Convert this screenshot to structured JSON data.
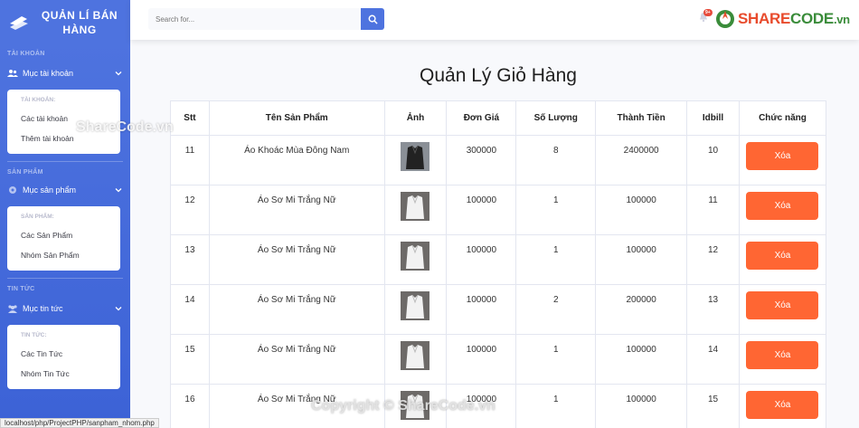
{
  "sidebar": {
    "brand": "QUẢN LÍ BÁN HÀNG",
    "sections": [
      {
        "heading": "TÀI KHOẢN",
        "toggle": "Mục tài khoản",
        "menu_header": "TÀI KHOẢN:",
        "items": [
          "Các tài khoản",
          "Thêm tài khoản"
        ]
      },
      {
        "heading": "SẢN PHẨM",
        "toggle": "Mục sản phẩm",
        "menu_header": "SẢN PHẨM:",
        "items": [
          "Các Sản Phẩm",
          "Nhóm Sản Phẩm"
        ]
      },
      {
        "heading": "TIN TỨC",
        "toggle": "Mục tin tức",
        "menu_header": "TIN TỨC:",
        "items": [
          "Các Tin Tức",
          "Nhóm Tin Tức"
        ]
      }
    ]
  },
  "topbar": {
    "search_placeholder": "Search for...",
    "alerts_badge": "9+",
    "logo_part1": "SHARE",
    "logo_part2": "CODE",
    "logo_part3": ".vn"
  },
  "page_title": "Quản Lý Giỏ Hàng",
  "table": {
    "headers": [
      "Stt",
      "Tên Sản Phẩm",
      "Ảnh",
      "Đơn Giá",
      "Số Lượng",
      "Thành Tiền",
      "Idbill",
      "Chức năng"
    ],
    "delete_label": "Xóa",
    "rows": [
      {
        "stt": "11",
        "name": "Áo Khoác Mùa Đông Nam",
        "price": "300000",
        "qty": "8",
        "total": "2400000",
        "idbill": "10"
      },
      {
        "stt": "12",
        "name": "Áo Sơ Mi Trắng Nữ",
        "price": "100000",
        "qty": "1",
        "total": "100000",
        "idbill": "11"
      },
      {
        "stt": "13",
        "name": "Áo Sơ Mi Trắng Nữ",
        "price": "100000",
        "qty": "1",
        "total": "100000",
        "idbill": "12"
      },
      {
        "stt": "14",
        "name": "Áo Sơ Mi Trắng Nữ",
        "price": "100000",
        "qty": "2",
        "total": "200000",
        "idbill": "13"
      },
      {
        "stt": "15",
        "name": "Áo Sơ Mi Trắng Nữ",
        "price": "100000",
        "qty": "1",
        "total": "100000",
        "idbill": "14"
      },
      {
        "stt": "16",
        "name": "Áo Sơ Mi Trắng Nữ",
        "price": "100000",
        "qty": "1",
        "total": "100000",
        "idbill": "15"
      }
    ]
  },
  "status_url": "localhost/php/ProjectPHP/sanpham_nhom.php",
  "watermarks": {
    "w1": "ShareCode.vn",
    "w2": "Copyright © ShareCode.vn"
  },
  "colors": {
    "sidebar": "#4e73df",
    "accent": "#4e73df",
    "delete": "#ff6633"
  }
}
